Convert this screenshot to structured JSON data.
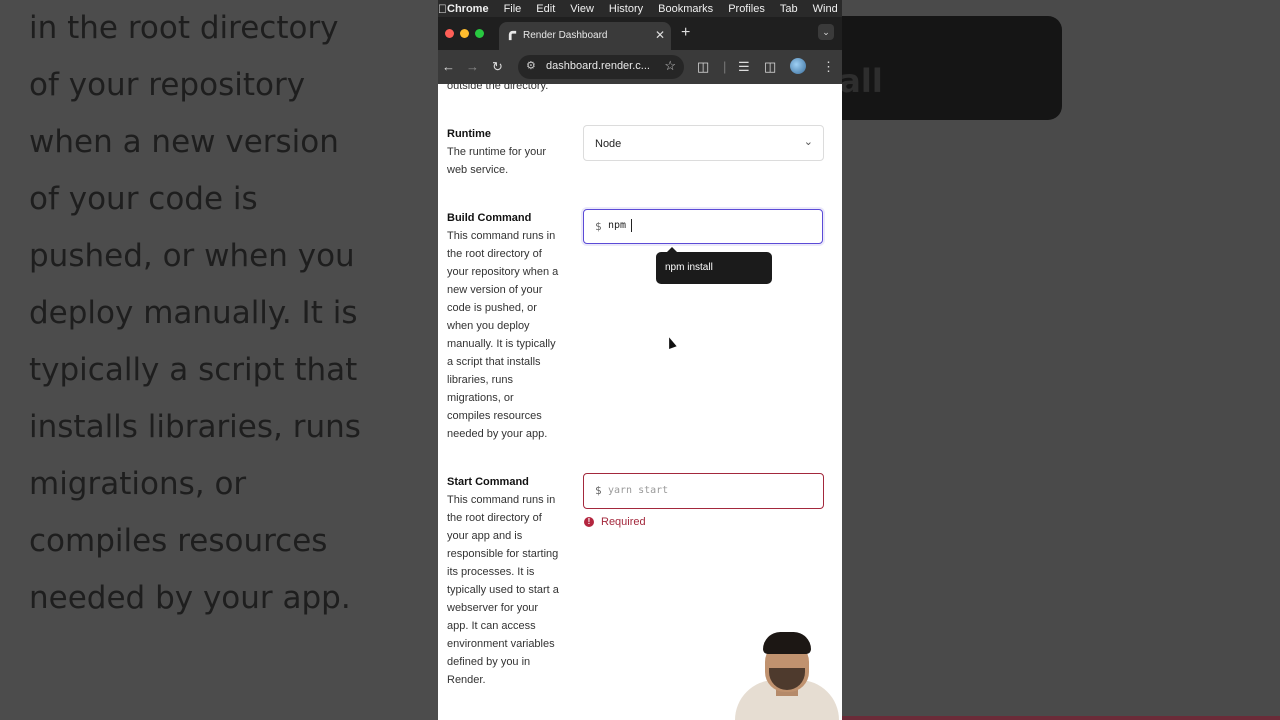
{
  "background": {
    "left_lines": [
      "in the root directory",
      "of your repository",
      "when a new version",
      "of your code is",
      "pushed, or when you",
      "deploy manually. It is",
      "typically a script that",
      "installs libraries, runs",
      "migrations, or",
      "compiles resources",
      "needed by your app."
    ],
    "right_text": "tall"
  },
  "menubar": {
    "items": [
      "Chrome",
      "File",
      "Edit",
      "View",
      "History",
      "Bookmarks",
      "Profiles",
      "Tab",
      "Wind"
    ]
  },
  "browser": {
    "tab_title": "Render Dashboard",
    "url": "dashboard.render.c...",
    "icons": {
      "back": "arrow-left-icon",
      "forward": "arrow-right-icon",
      "reload": "reload-icon",
      "site_info": "tune-icon",
      "bookmark": "star-icon",
      "extensions": "puzzle-icon",
      "media": "media-control-icon",
      "sidebar": "side-panel-icon",
      "menu": "kebab-menu-icon"
    }
  },
  "form": {
    "overflow_text": "outside the directory.",
    "runtime": {
      "label": "Runtime",
      "description": "The runtime for your web service.",
      "value": "Node"
    },
    "build_command": {
      "label": "Build Command",
      "description": "This command runs in the root directory of your repository when a new version of your code is pushed, or when you deploy manually. It is typically a script that installs libraries, runs migrations, or compiles resources needed by your app.",
      "prompt": "$",
      "value": "npm ",
      "suggestion": "npm install"
    },
    "start_command": {
      "label": "Start Command",
      "description": "This command runs in the root directory of your app and is responsible for starting its processes. It is typically used to start a webserver for your app. It can access environment variables defined by you in Render.",
      "prompt": "$",
      "placeholder": "yarn start",
      "error": "Required"
    }
  },
  "colors": {
    "focus_border": "#5b4bd6",
    "error": "#a3283c"
  }
}
